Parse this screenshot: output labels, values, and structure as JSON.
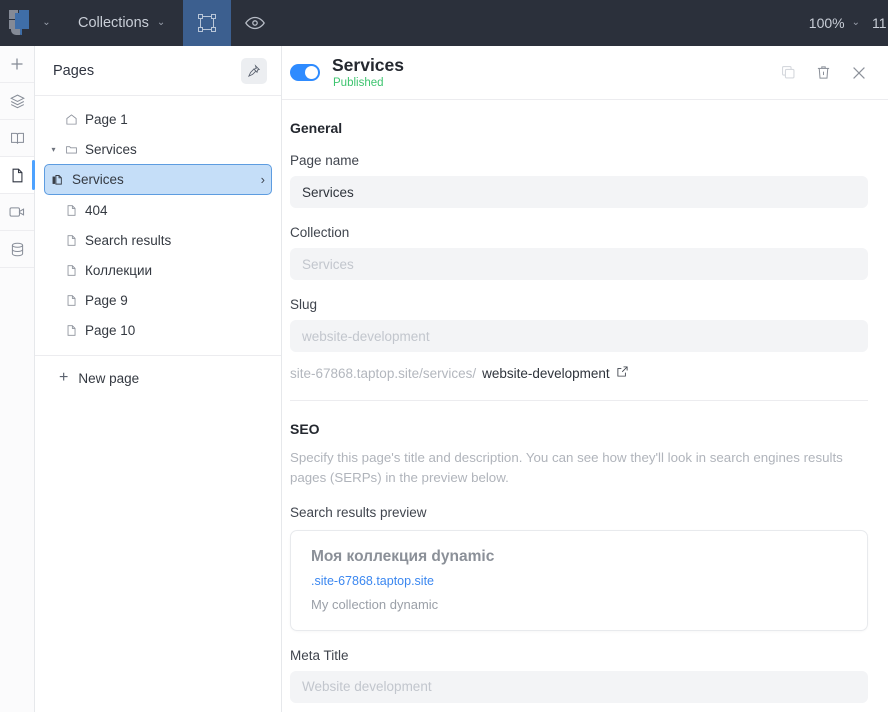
{
  "topbar": {
    "logo_icon": "taptop-logo",
    "logo_caret": "⌄",
    "collections_label": "Collections",
    "collections_caret": "⌄",
    "select_tool_icon": "selection-frame-icon",
    "preview_icon": "eye-icon",
    "zoom_level": "100%",
    "zoom_caret": "⌄",
    "cut_off_label": "11"
  },
  "rail": {
    "items": [
      {
        "icon": "plus-icon",
        "name": "add"
      },
      {
        "icon": "layers-icon",
        "name": "layers"
      },
      {
        "icon": "book-icon",
        "name": "library"
      },
      {
        "icon": "page-icon",
        "name": "pages"
      },
      {
        "icon": "video-icon",
        "name": "media"
      },
      {
        "icon": "database-icon",
        "name": "database"
      }
    ]
  },
  "pages": {
    "title": "Pages",
    "pin_icon": "pin-icon",
    "items": [
      {
        "label": "Page 1",
        "icon": "home-icon",
        "indent": false,
        "selected": false,
        "twisty": ""
      },
      {
        "label": "Services",
        "icon": "folder-icon",
        "indent": false,
        "selected": false,
        "twisty": "▾"
      },
      {
        "label": "Services",
        "icon": "collection-page-icon",
        "indent": true,
        "selected": true,
        "twisty": ""
      },
      {
        "label": "404",
        "icon": "page-icon",
        "indent": false,
        "selected": false,
        "twisty": ""
      },
      {
        "label": "Search results",
        "icon": "page-icon",
        "indent": false,
        "selected": false,
        "twisty": ""
      },
      {
        "label": "Коллекции",
        "icon": "page-icon",
        "indent": false,
        "selected": false,
        "twisty": ""
      },
      {
        "label": "Page 9",
        "icon": "page-icon",
        "indent": false,
        "selected": false,
        "twisty": ""
      },
      {
        "label": "Page 10",
        "icon": "page-icon",
        "indent": false,
        "selected": false,
        "twisty": ""
      }
    ],
    "new_page_label": "New page",
    "new_page_icon": "plus-icon"
  },
  "panel": {
    "toggle_on": true,
    "title": "Services",
    "status": "Published",
    "actions": [
      {
        "icon": "duplicate-icon",
        "name": "duplicate"
      },
      {
        "icon": "trash-icon",
        "name": "delete"
      },
      {
        "icon": "close-icon",
        "name": "close"
      }
    ],
    "general": {
      "section_title": "General",
      "page_name_label": "Page name",
      "page_name_value": "Services",
      "collection_label": "Collection",
      "collection_placeholder": "Services",
      "slug_label": "Slug",
      "slug_placeholder": "website-development",
      "url_prefix": "site-67868.taptop.site/services/",
      "url_slug": "website-development",
      "url_external_icon": "external-link-icon"
    },
    "seo": {
      "section_title": "SEO",
      "description": "Specify this page's title and description. You can see how they'll look in search engines results pages (SERPs) in the preview below.",
      "preview_label": "Search results preview",
      "preview_title": "Моя коллекция dynamic",
      "preview_url": ".site-67868.taptop.site",
      "preview_desc": "My collection dynamic",
      "meta_title_label": "Meta Title",
      "meta_title_placeholder": "Website development"
    }
  },
  "colors": {
    "topbar_bg": "#2b303b",
    "tool_active": "#3c5f8f",
    "toggle_on": "#2e8bff",
    "published_green": "#3ec46f",
    "selected_row_bg": "#c5def8",
    "selected_row_border": "#5d9ce0",
    "link_blue": "#3b87f0",
    "rail_active_indicator": "#4da2ff"
  }
}
